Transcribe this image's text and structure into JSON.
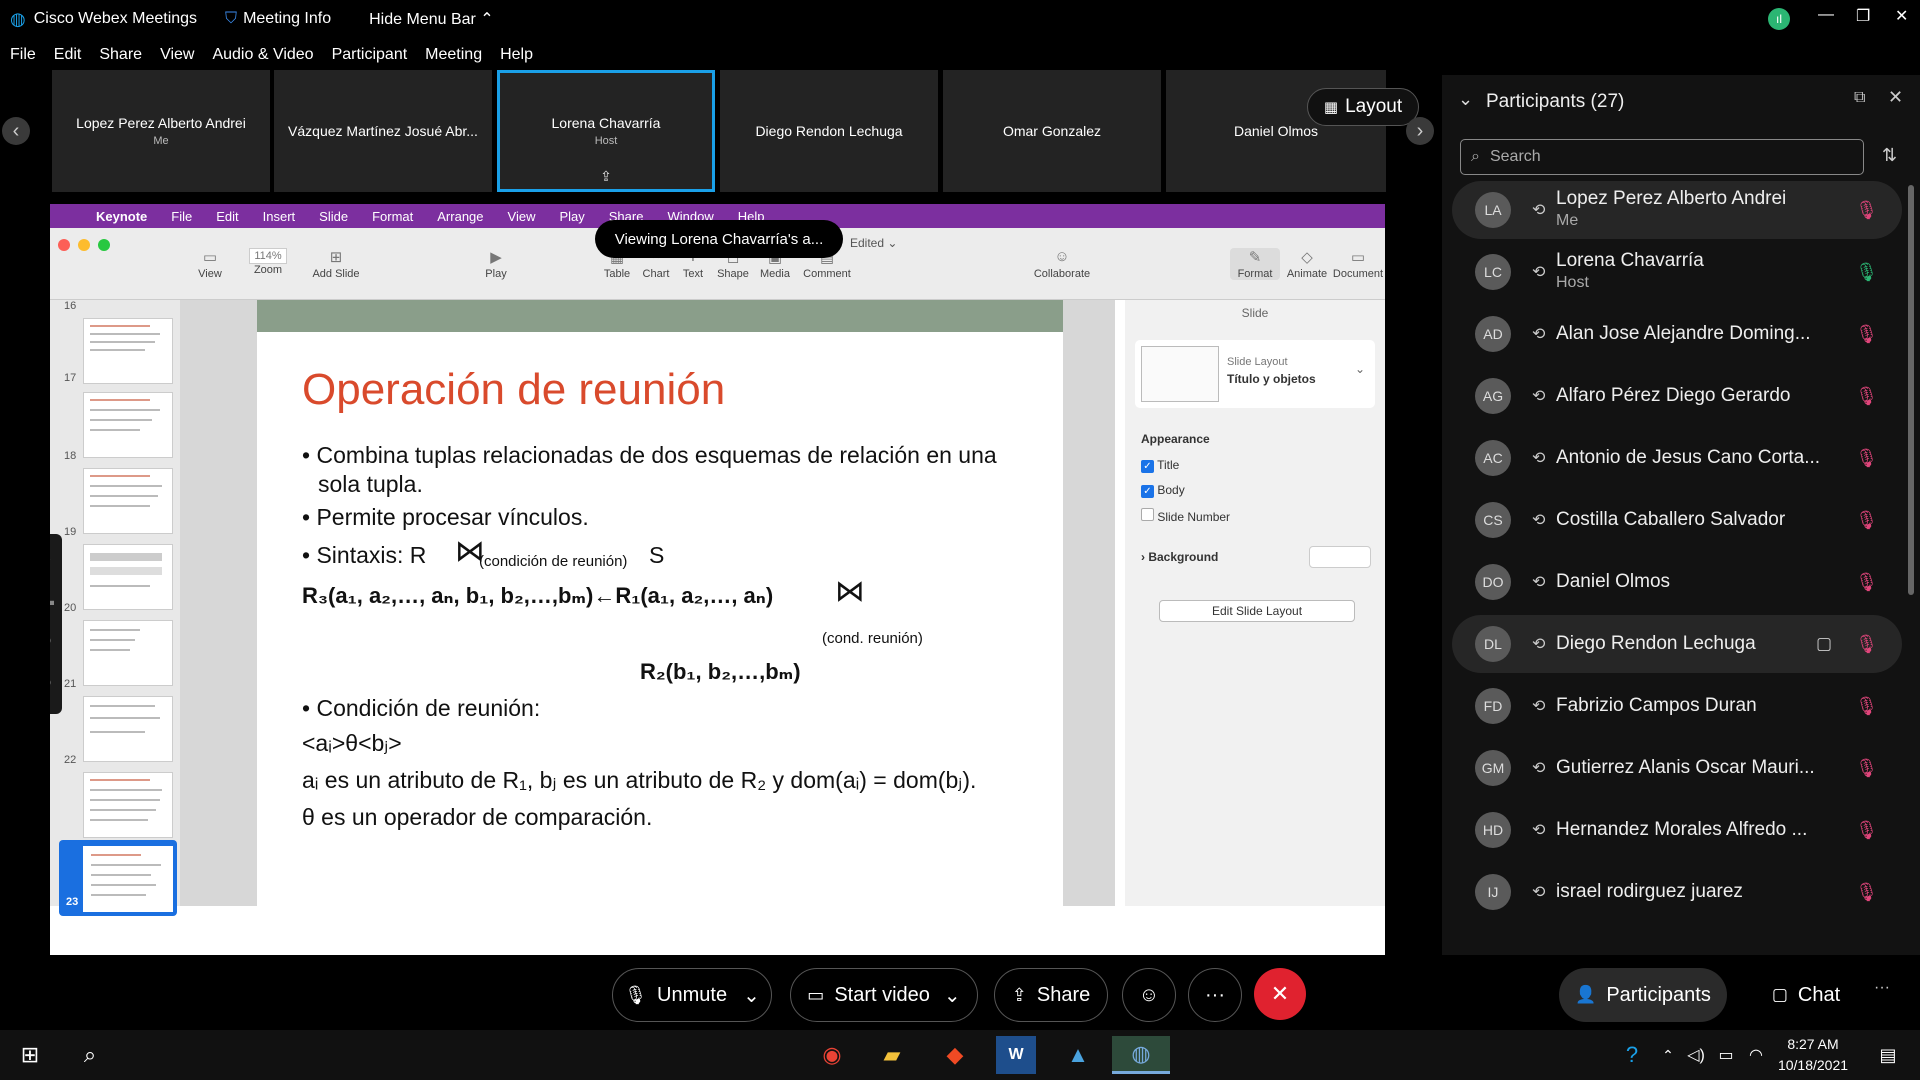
{
  "titlebar": {
    "app_name": "Cisco Webex Meetings",
    "meeting_info": "Meeting Info",
    "hide_menu_bar": "Hide Menu Bar"
  },
  "menu": [
    "File",
    "Edit",
    "Share",
    "View",
    "Audio & Video",
    "Participant",
    "Meeting",
    "Help"
  ],
  "filmstrip": {
    "tiles": [
      {
        "name": "Lopez Perez Alberto Andrei",
        "sub": "Me"
      },
      {
        "name": "Vázquez Martínez Josué Abr...",
        "sub": ""
      },
      {
        "name": "Lorena Chavarría",
        "sub": "Host"
      },
      {
        "name": "Diego Rendon Lechuga",
        "sub": ""
      },
      {
        "name": "Omar Gonzalez",
        "sub": ""
      },
      {
        "name": "Daniel Olmos",
        "sub": ""
      }
    ],
    "layout_label": "Layout"
  },
  "keynote": {
    "mac_menu": [
      "Keynote",
      "File",
      "Edit",
      "Insert",
      "Slide",
      "Format",
      "Arrange",
      "View",
      "Play",
      "Share",
      "Window",
      "Help"
    ],
    "viewing_banner": "Viewing Lorena Chavarría's a...",
    "edited": "Edited",
    "zoom_value": "114%",
    "toolbar": {
      "view": "View",
      "zoom": "Zoom",
      "add_slide": "Add Slide",
      "play": "Play",
      "table": "Table",
      "chart": "Chart",
      "text": "Text",
      "shape": "Shape",
      "media": "Media",
      "comment": "Comment",
      "collaborate": "Collaborate",
      "format": "Format",
      "animate": "Animate",
      "document": "Document"
    },
    "slide_numbers": [
      "16",
      "17",
      "18",
      "19",
      "20",
      "21",
      "22",
      "23"
    ],
    "slide": {
      "title": "Operación de reunión",
      "b1_line1": "Combina tuplas relacionadas de dos esquemas de relación en una",
      "b1_line2": "sola tupla.",
      "b2": "Permite procesar vínculos.",
      "b3": "Sintaxis: R",
      "b3_sub": "(condición de reunión)",
      "b3_s": "S",
      "formula1": "R₃(a₁, a₂,…, aₙ, b₁, b₂,…,bₘ)←R₁(a₁, a₂,…, aₙ)",
      "formula_cond": "(cond. reunión)",
      "formula2": "R₂(b₁, b₂,…,bₘ)",
      "b4": "Condición de reunión:",
      "cond_expr": "<aᵢ>θ<bⱼ>",
      "desc1": "aᵢ es un atributo de R₁, bⱼ es un atributo de R₂ y dom(aᵢ) = dom(bⱼ).",
      "desc2": "θ es un operador de comparación."
    },
    "inspector": {
      "header": "Slide",
      "layout_label": "Slide Layout",
      "layout_value": "Título y objetos",
      "appearance": "Appearance",
      "title_cb": "Title",
      "body_cb": "Body",
      "slide_number_cb": "Slide Number",
      "background": "Background",
      "edit_layout": "Edit Slide Layout"
    }
  },
  "participants_panel": {
    "title": "Participants (27)",
    "search_placeholder": "Search",
    "list": [
      {
        "initials": "LA",
        "name": "Lopez Perez Alberto Andrei",
        "role": "Me"
      },
      {
        "initials": "LC",
        "name": "Lorena Chavarría",
        "role": "Host"
      },
      {
        "initials": "AD",
        "name": "Alan Jose Alejandre Doming...",
        "role": ""
      },
      {
        "initials": "AG",
        "name": "Alfaro Pérez Diego Gerardo",
        "role": ""
      },
      {
        "initials": "AC",
        "name": "Antonio de Jesus Cano Corta...",
        "role": ""
      },
      {
        "initials": "CS",
        "name": "Costilla Caballero Salvador",
        "role": ""
      },
      {
        "initials": "DO",
        "name": "Daniel Olmos",
        "role": ""
      },
      {
        "initials": "DL",
        "name": "Diego Rendon Lechuga",
        "role": ""
      },
      {
        "initials": "FD",
        "name": "Fabrizio Campos Duran",
        "role": ""
      },
      {
        "initials": "GM",
        "name": "Gutierrez Alanis Oscar Mauri...",
        "role": ""
      },
      {
        "initials": "HD",
        "name": "Hernandez Morales Alfredo ...",
        "role": ""
      },
      {
        "initials": "IJ",
        "name": "israel rodirguez juarez",
        "role": ""
      }
    ]
  },
  "controls": {
    "unmute": "Unmute",
    "start_video": "Start video",
    "share": "Share",
    "participants": "Participants",
    "chat": "Chat"
  },
  "taskbar": {
    "time": "8:27 AM",
    "date": "10/18/2021"
  }
}
